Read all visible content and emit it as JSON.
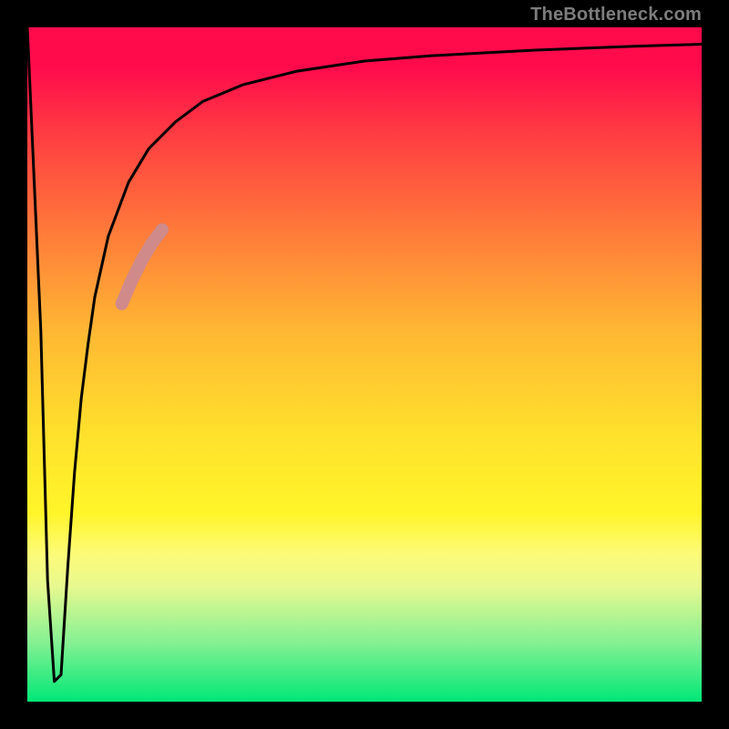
{
  "attribution": "TheBottleneck.com",
  "chart_data": {
    "type": "line",
    "title": "",
    "xlabel": "",
    "ylabel": "",
    "xlim": [
      0,
      100
    ],
    "ylim": [
      0,
      100
    ],
    "series": [
      {
        "name": "main-curve",
        "color": "#000000",
        "x": [
          0.0,
          2.0,
          3.0,
          4.0,
          5.0,
          6.0,
          7.0,
          8.0,
          9.0,
          10.0,
          12.0,
          15.0,
          18.0,
          22.0,
          26.0,
          32.0,
          40.0,
          50.0,
          60.0,
          75.0,
          90.0,
          100.0
        ],
        "y": [
          100.0,
          55.0,
          18.0,
          3.0,
          4.0,
          20.0,
          34.0,
          45.0,
          53.0,
          60.0,
          69.0,
          77.0,
          82.0,
          86.0,
          89.0,
          91.5,
          93.5,
          95.0,
          95.8,
          96.6,
          97.2,
          97.5
        ]
      },
      {
        "name": "highlight-segment",
        "color": "#d08a8a",
        "thickness": 14,
        "x": [
          14.0,
          15.5,
          17.0,
          18.5,
          20.0
        ],
        "y": [
          59.0,
          62.5,
          65.5,
          68.0,
          70.0
        ]
      }
    ],
    "background_gradient": [
      {
        "stop": 0.0,
        "color": "#ff0b4c"
      },
      {
        "stop": 0.3,
        "color": "#ff793a"
      },
      {
        "stop": 0.6,
        "color": "#ffe02c"
      },
      {
        "stop": 0.8,
        "color": "#fdfb77"
      },
      {
        "stop": 1.0,
        "color": "#00e877"
      }
    ]
  }
}
